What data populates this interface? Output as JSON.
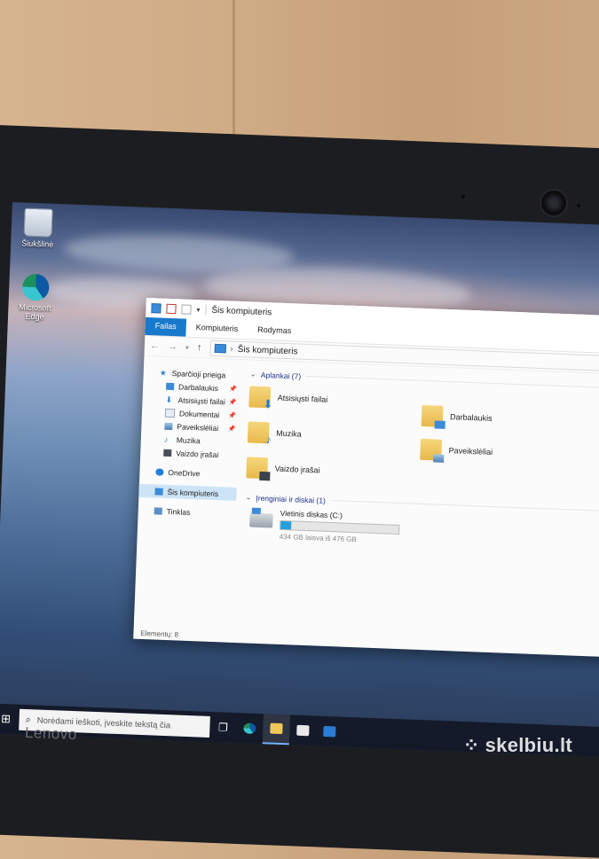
{
  "desktop": {
    "icons": [
      {
        "label": "Šiukšlinė",
        "icon": "recycle-bin-icon"
      },
      {
        "label": "Microsoft Edge",
        "icon": "edge-icon"
      }
    ]
  },
  "explorer": {
    "title": "Šis kompiuteris",
    "ribbon_tabs": [
      "Failas",
      "Kompiuteris",
      "Rodymas"
    ],
    "address": "Šis kompiuteris",
    "nav": {
      "quick_access": "Sparčioji prieiga",
      "quick_items": [
        {
          "label": "Darbalaukis",
          "icon": "desktop-icon",
          "pinned": true
        },
        {
          "label": "Atsisiųsti failai",
          "icon": "download-icon",
          "pinned": true
        },
        {
          "label": "Dokumentai",
          "icon": "document-icon",
          "pinned": true
        },
        {
          "label": "Paveikslėliai",
          "icon": "pictures-icon",
          "pinned": true
        },
        {
          "label": "Muzika",
          "icon": "music-icon",
          "pinned": false
        },
        {
          "label": "Vaizdo įrašai",
          "icon": "video-icon",
          "pinned": false
        }
      ],
      "onedrive": "OneDrive",
      "this_pc": "Šis kompiuteris",
      "network": "Tinklas"
    },
    "folders_header": "Aplankai (7)",
    "folders": [
      {
        "label": "Atsisiųsti failai",
        "icon": "download-icon"
      },
      {
        "label": "Darbalaukis",
        "icon": "desktop-icon"
      },
      {
        "label": "Muzika",
        "icon": "music-icon"
      },
      {
        "label": "Paveikslėliai",
        "icon": "pictures-icon"
      },
      {
        "label": "Vaizdo įrašai",
        "icon": "video-icon"
      }
    ],
    "drives_header": "Įrenginiai ir diskai (1)",
    "drive": {
      "name": "Vietinis diskas (C:)",
      "usage_text": "434 GB laisva iš 476 GB",
      "used_fraction": 0.088
    },
    "status": "Elementų: 8",
    "colors": {
      "accent": "#1979ca",
      "selection": "#cce4f7",
      "group_header": "#1e3287"
    }
  },
  "taskbar": {
    "search_placeholder": "Norėdami ieškoti, įveskite tekstą čia",
    "icons": [
      "start-icon",
      "task-view-icon",
      "edge-icon",
      "file-explorer-icon",
      "store-icon",
      "mail-icon"
    ]
  },
  "device": {
    "brand": "Lenovo"
  },
  "watermark": "skelbiu.lt"
}
